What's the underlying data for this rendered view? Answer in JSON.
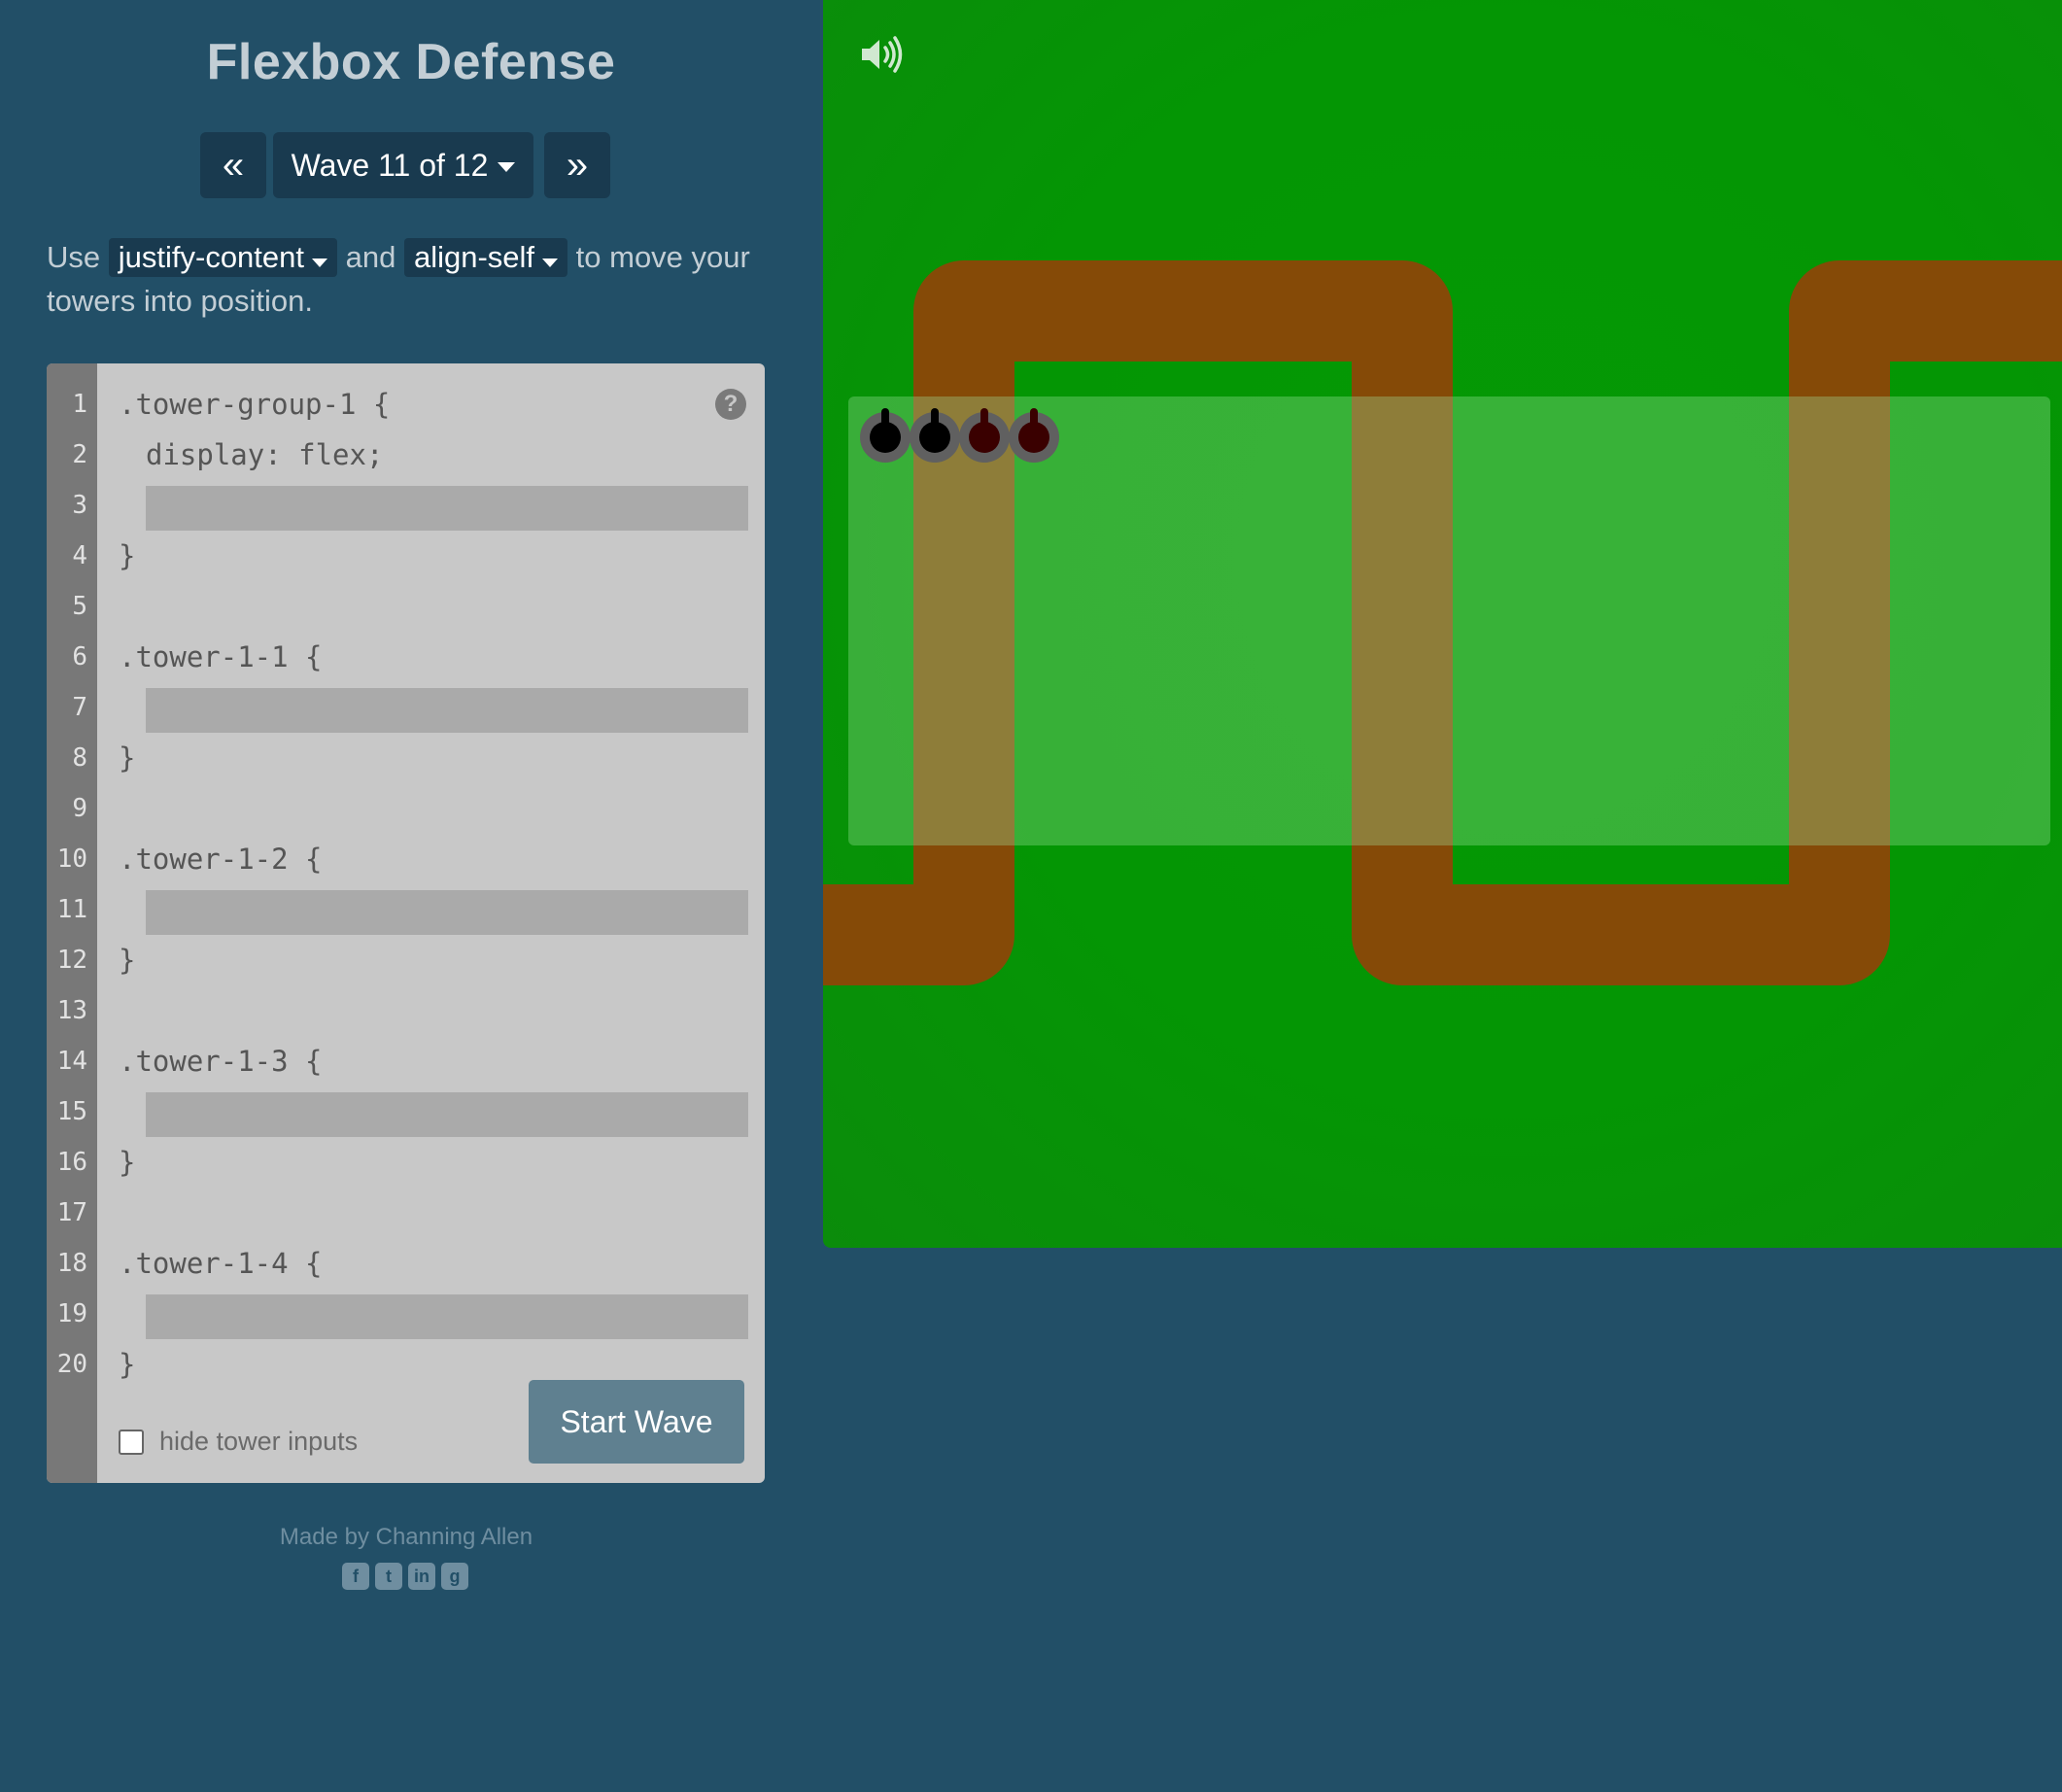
{
  "title": "Flexbox Defense",
  "wave_nav": {
    "prev_label": "«",
    "select_label": "Wave 11 of 12",
    "next_label": "»"
  },
  "instructions": {
    "prefix": "Use ",
    "prop1": "justify-content",
    "middle": " and ",
    "prop2": "align-self",
    "suffix": " to move your towers into position."
  },
  "editor": {
    "line_numbers": [
      "1",
      "2",
      "3",
      "4",
      "5",
      "6",
      "7",
      "8",
      "9",
      "10",
      "11",
      "12",
      "13",
      "14",
      "15",
      "16",
      "17",
      "18",
      "19",
      "20"
    ],
    "lines": {
      "l1": ".tower-group-1 {",
      "l2": "display: flex;",
      "l4": "}",
      "l6": ".tower-1-1 {",
      "l8": "}",
      "l10": ".tower-1-2 {",
      "l12": "}",
      "l14": ".tower-1-3 {",
      "l16": "}",
      "l18": ".tower-1-4 {",
      "l20": "}"
    },
    "inputs": [
      "",
      "",
      "",
      "",
      ""
    ],
    "help_label": "?",
    "hide_inputs_label": "hide tower inputs",
    "hide_inputs_checked": false,
    "start_label": "Start Wave"
  },
  "footer": {
    "credit": "Made by Channing Allen",
    "social_icons": [
      "facebook-icon",
      "twitter-icon",
      "linkedin-icon",
      "github-icon"
    ]
  },
  "board": {
    "sound_icon": "speaker-volume-icon",
    "towers": [
      {
        "name": "tower-1-1",
        "core_color": "#000000"
      },
      {
        "name": "tower-1-2",
        "core_color": "#000000"
      },
      {
        "name": "tower-1-3",
        "core_color": "#3a0000"
      },
      {
        "name": "tower-1-4",
        "core_color": "#3a0000"
      }
    ],
    "colors": {
      "grass": "#049604",
      "path": "#854a07",
      "tower_group_zone": "rgba(160,230,160,0.33)"
    }
  }
}
